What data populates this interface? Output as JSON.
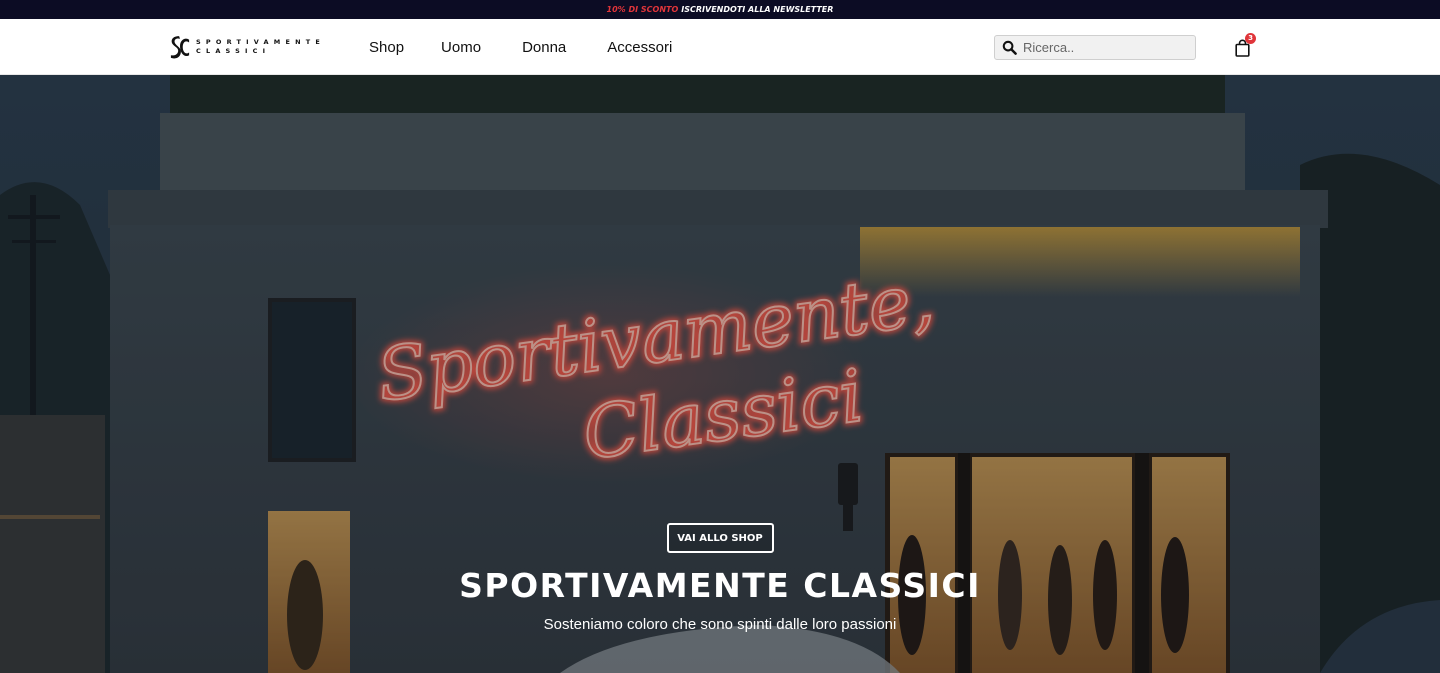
{
  "announcement": {
    "promo": "10% DI SCONTO",
    "cta": "ISCRIVENDOTI ALLA NEWSLETTER"
  },
  "header": {
    "logo": {
      "line1": "SPORTIVAMENTE",
      "line2": "CLASSICI"
    },
    "nav": [
      {
        "label": "Shop"
      },
      {
        "label": "Uomo"
      },
      {
        "label": "Donna"
      },
      {
        "label": "Accessori"
      }
    ],
    "search": {
      "placeholder": "Ricerca.."
    },
    "cart": {
      "count": "3"
    }
  },
  "hero": {
    "neon_line1": "Sportivamente,",
    "neon_line2": "Classici",
    "button_label": "VAI ALLO SHOP",
    "title": "SPORTIVAMENTE CLASSICI",
    "subtitle": "Sosteniamo coloro che sono spinti dalle loro passioni",
    "colors": {
      "neon": "#ff6a55",
      "accent": "#e0353a",
      "announce_bg": "#0c0c24"
    }
  }
}
